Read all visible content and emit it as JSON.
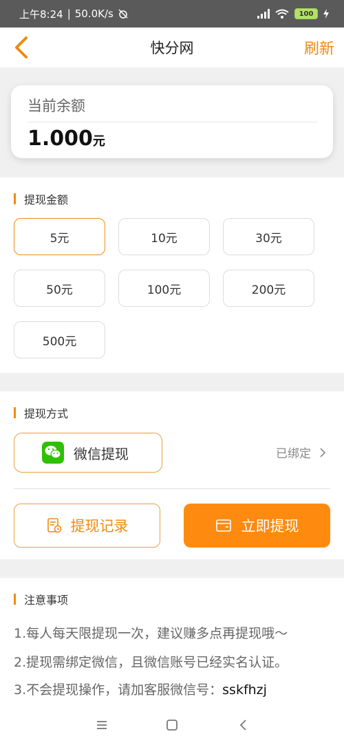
{
  "status": {
    "time": "上午8:24",
    "speed": "50.0K/s",
    "battery": "100"
  },
  "header": {
    "title": "快分网",
    "refresh_label": "刷新"
  },
  "balance": {
    "label": "当前余额",
    "amount": "1.000",
    "unit": "元"
  },
  "withdraw_amount": {
    "title": "提现金额",
    "options": [
      "5元",
      "10元",
      "30元",
      "50元",
      "100元",
      "200元",
      "500元"
    ],
    "selected_index": 0
  },
  "withdraw_method": {
    "title": "提现方式",
    "method_label": "微信提现",
    "status": "已绑定",
    "record_label": "提现记录",
    "submit_label": "立即提现"
  },
  "notes": {
    "title": "注意事项",
    "items": [
      "1.每人每天限提现一次，建议赚多点再提现哦～",
      "2.提现需绑定微信，且微信账号已经实名认证。",
      "3.不会提现操作，请加客服微信号："
    ],
    "service_account": "sskfhzj"
  },
  "colors": {
    "accent": "#f08a10",
    "primary_button": "#ff8a10",
    "wechat": "#2dc100"
  },
  "icons": [
    "back-arrow-icon",
    "wechat-icon",
    "record-icon",
    "wallet-icon",
    "chevron-right-icon",
    "menu-icon",
    "home-icon",
    "back-icon"
  ]
}
